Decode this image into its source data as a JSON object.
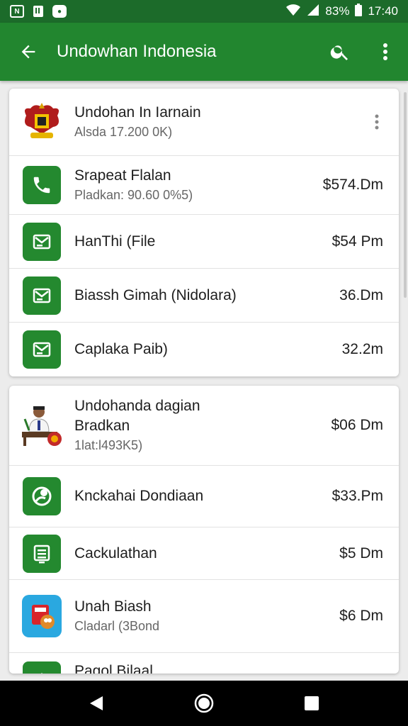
{
  "status_bar": {
    "battery": "83%",
    "time": "17:40"
  },
  "app_bar": {
    "title": "Undowhan Indonesia"
  },
  "card1": {
    "header": {
      "title": "Undohan In Iarnain",
      "subtitle": "Alsda 17.200 0K)"
    },
    "items": [
      {
        "title": "Srapeat Flalan",
        "subtitle": "Pladkan: 90.60 0%5)",
        "price": "$574.Dm",
        "icon": "phone-icon"
      },
      {
        "title": "HanThi (File",
        "subtitle": "",
        "price": "$54 Pm",
        "icon": "mail-icon"
      },
      {
        "title": "Biassh Gimah (Nidolara)",
        "subtitle": "",
        "price": "36.Dm",
        "icon": "mail-icon"
      },
      {
        "title": "Caplaka Paib)",
        "subtitle": "",
        "price": "32.2m",
        "icon": "mail-icon"
      }
    ]
  },
  "card2": {
    "header": {
      "title": "Undohanda dagian",
      "title2": "Bradkan",
      "subtitle": "1lat:l493K5)",
      "price": "$06 Dm"
    },
    "items": [
      {
        "title": "Knckahai Dondiaan",
        "subtitle": "",
        "price": "$33.Pm",
        "icon": "leaf-icon"
      },
      {
        "title": "Cackulathan",
        "subtitle": "",
        "price": "$5 Dm",
        "icon": "list-icon"
      },
      {
        "title": "Unah Biash",
        "subtitle": "Cladarl (3Bond",
        "price": "$6 Dm",
        "icon": "app-icon"
      },
      {
        "title": "Pagol Bilaal",
        "subtitle": "",
        "price": "",
        "icon": "upload-icon"
      }
    ]
  },
  "colors": {
    "status_bar": "#1c6b2a",
    "app_bar": "#22862f",
    "icon_green": "#24892f"
  }
}
